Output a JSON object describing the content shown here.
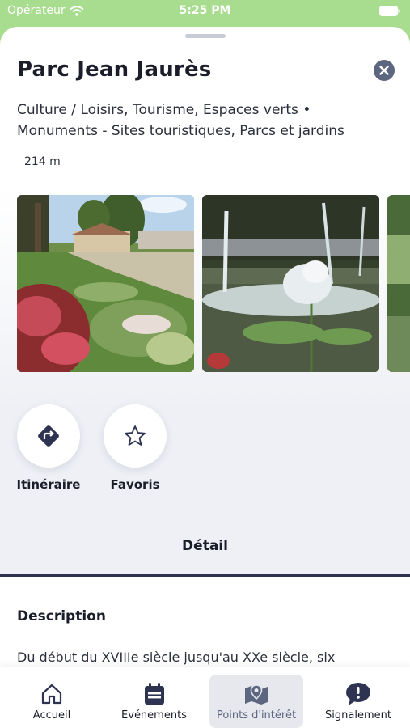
{
  "status_bar": {
    "carrier": "Opérateur",
    "time": "5:25 PM"
  },
  "place": {
    "title": "Parc Jean Jaurès",
    "categories_line1": "Culture / Loisirs, Tourisme, Espaces verts  •",
    "categories_line2": "Monuments - Sites touristiques, Parcs et jardins",
    "distance": "214 m"
  },
  "actions": {
    "itinerary_label": "Itinéraire",
    "favorites_label": "Favoris"
  },
  "detail_tab": {
    "label": "Détail"
  },
  "description": {
    "heading": "Description",
    "text": "Du début du XVIIIe siècle jusqu'au XXe siècle, six"
  },
  "tab_bar": {
    "items": [
      {
        "label": "Accueil",
        "icon": "home-icon"
      },
      {
        "label": "Evénements",
        "icon": "calendar-icon"
      },
      {
        "label": "Points d'intérêt",
        "icon": "map-pin-icon",
        "active": true
      },
      {
        "label": "Signalement",
        "icon": "alert-bubble-icon"
      }
    ]
  },
  "colors": {
    "accent": "#2e3352",
    "icon_gray": "#5d6680",
    "status_bar_bg": "#a8dc8e"
  }
}
